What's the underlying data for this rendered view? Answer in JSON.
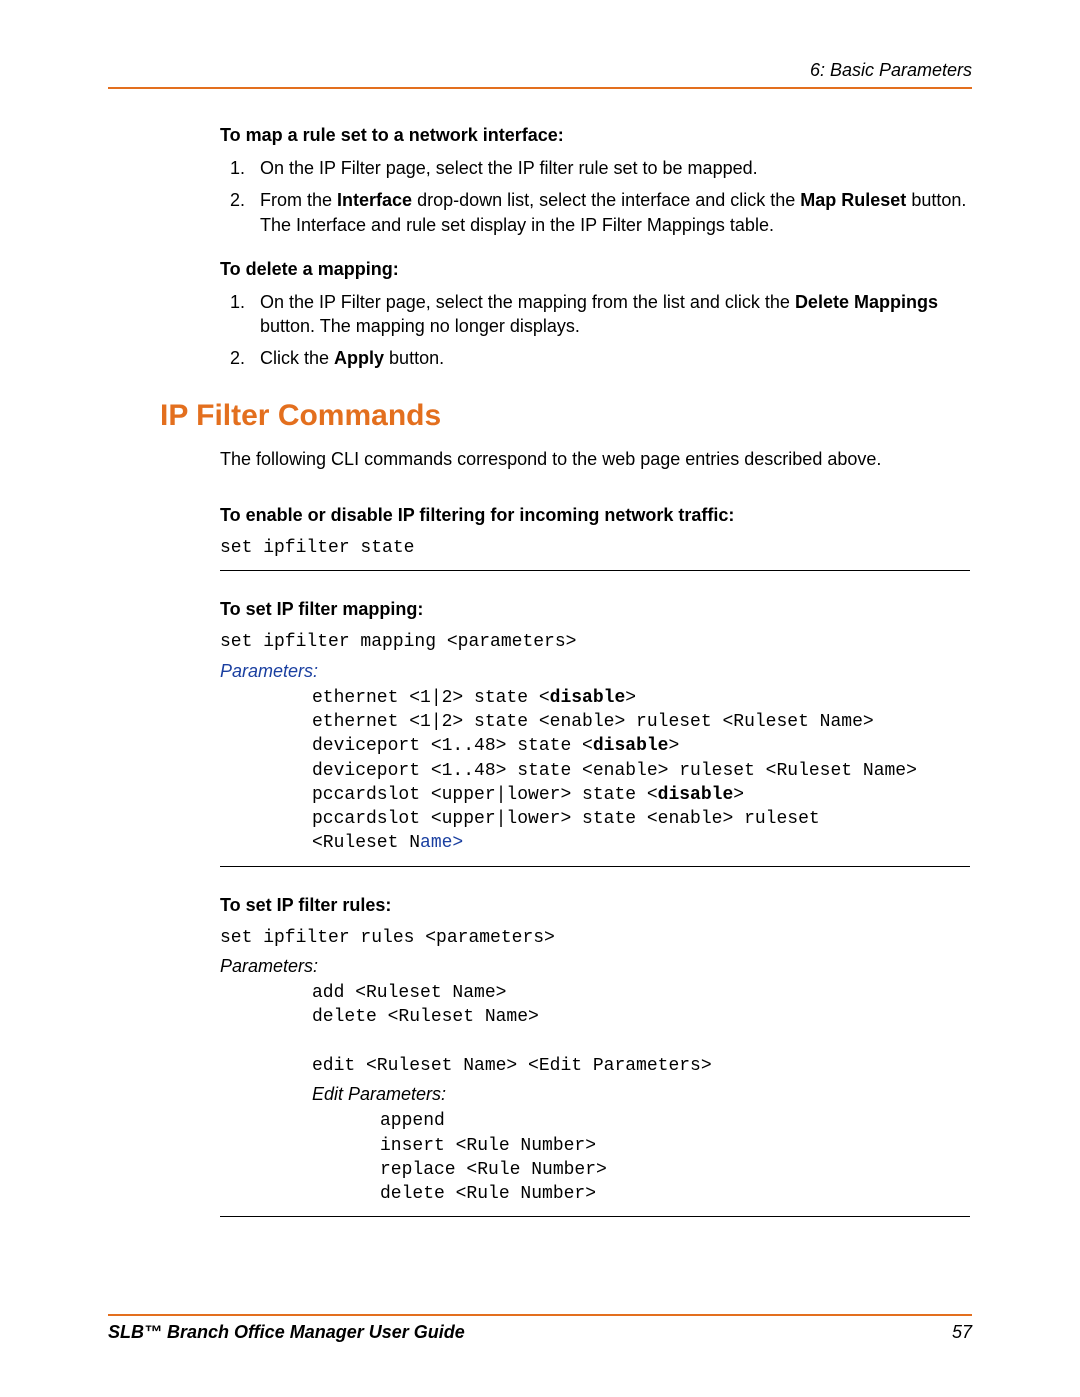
{
  "chapter_header": "6: Basic Parameters",
  "map_section": {
    "title": "To map a rule set to a network interface:",
    "step1": "On the IP Filter page, select the IP filter rule set to be mapped.",
    "step2_pre": "From the ",
    "step2_b1": "Interface",
    "step2_mid": " drop-down list, select the interface and click the ",
    "step2_b2": "Map Ruleset",
    "step2_post": " button. The Interface and rule set display in the IP Filter Mappings table."
  },
  "delete_section": {
    "title": "To delete a mapping:",
    "step1_pre": "On the IP Filter page, select the mapping from the list and click the ",
    "step1_b1": "Delete Mappings",
    "step1_post": " button. The mapping no longer displays.",
    "step2_pre": "Click the ",
    "step2_b1": "Apply",
    "step2_post": " button."
  },
  "filter_commands": {
    "heading": "IP Filter Commands",
    "intro": "The following CLI commands correspond to the web page entries described above.",
    "enable_title": "To enable or disable IP filtering for incoming network traffic:",
    "enable_cmd": "set ipfilter state",
    "mapping_title": "To set IP filter mapping:",
    "mapping_cmd": "set ipfilter mapping <parameters>",
    "params_label": "Parameters:",
    "mapping_params_1a": "ethernet <1|2> state <",
    "mapping_params_1b": "disable",
    "mapping_params_1c": ">",
    "mapping_params_2": "ethernet <1|2> state <enable> ruleset <Ruleset Name>",
    "mapping_params_3a": "deviceport <1..48> state <",
    "mapping_params_3b": "disable",
    "mapping_params_3c": ">",
    "mapping_params_4": "deviceport <1..48> state <enable> ruleset <Ruleset Name>",
    "mapping_params_5a": "pccardslot <upper|lower> state <",
    "mapping_params_5b": "disable",
    "mapping_params_5c": ">",
    "mapping_params_6": "pccardslot <upper|lower> state <enable> ruleset ",
    "mapping_params_7a": "<Ruleset N",
    "mapping_params_7b": "ame>",
    "rules_title": "To set IP filter rules:",
    "rules_cmd": "set ipfilter rules <parameters>",
    "rules_p1": "add <Ruleset Name>",
    "rules_p2": "delete <Ruleset Name>",
    "rules_p3": "edit <Ruleset Name> <Edit Parameters>",
    "edit_params_label": "Edit Parameters:",
    "rules_e1": "append",
    "rules_e2": "insert <Rule Number>",
    "rules_e3": "replace <Rule Number>",
    "rules_e4": "delete <Rule Number>"
  },
  "footer": {
    "left": "SLB™ Branch Office Manager User Guide",
    "page": "57"
  }
}
